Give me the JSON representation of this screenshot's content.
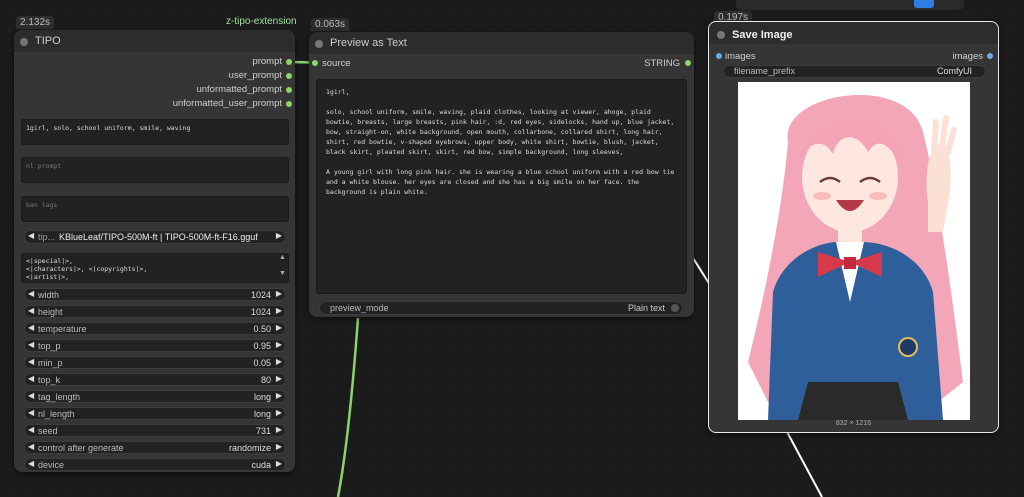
{
  "tipo": {
    "time": "2.132s",
    "extension": "z-tipo-extension",
    "title": "TIPO",
    "outputs": [
      "prompt",
      "user_prompt",
      "unformatted_prompt",
      "unformatted_user_prompt"
    ],
    "tags_text": "1girl, solo, school uniform, smile, waving",
    "nl_prompt_placeholder": "nl prompt",
    "ban_tags_placeholder": "ban tags",
    "model_label": "tip...",
    "model_value": "KBlueLeaf/TIPO-500M-ft | TIPO-500M-ft-F16.gguf",
    "format_text": "<|special|>,\n<|characters|>, <|copyrights|>,\n<|artist|>,",
    "widgets": [
      {
        "label": "width",
        "value": "1024"
      },
      {
        "label": "height",
        "value": "1024"
      },
      {
        "label": "temperature",
        "value": "0.50"
      },
      {
        "label": "top_p",
        "value": "0.95"
      },
      {
        "label": "min_p",
        "value": "0.05"
      },
      {
        "label": "top_k",
        "value": "80"
      },
      {
        "label": "tag_length",
        "value": "long"
      },
      {
        "label": "nl_length",
        "value": "long"
      },
      {
        "label": "seed",
        "value": "731"
      },
      {
        "label": "control after generate",
        "value": "randomize"
      },
      {
        "label": "device",
        "value": "cuda"
      }
    ]
  },
  "preview": {
    "time": "0.063s",
    "title": "Preview as Text",
    "input": "source",
    "output": "STRING",
    "text_line1": "1girl,",
    "text_para1": "solo, school uniform, smile, waving, plaid clothes, looking at viewer, ahoge, plaid bowtie, breasts, large breasts, pink hair, :d, red eyes, sidelocks, hand up, blue jacket, bow, straight-on, white background, open mouth, collarbone, collared shirt, long hair, shirt, red bowtie, v-shaped eyebrows, upper body, white shirt, bowtie, blush, jacket, black skirt, pleated skirt, skirt, red bow, simple background, long sleeves,",
    "text_para2": "A young girl with long pink hair. she is wearing a blue school uniform with a red bow tie and a white blouse. her eyes are closed and she has a big smile on her face. the background is plain white.",
    "mode_label": "preview_mode",
    "mode_value": "Plain text"
  },
  "save": {
    "time": "0.197s",
    "title": "Save Image",
    "input": "images",
    "output": "images",
    "prefix_label": "filename_prefix",
    "prefix_value": "ComfyUI",
    "dimensions": "832 × 1216"
  },
  "colors": {
    "accent_green": "#8bd36a",
    "accent_blue": "#6aa9e6",
    "toolbar_active": "#2f7de1"
  }
}
